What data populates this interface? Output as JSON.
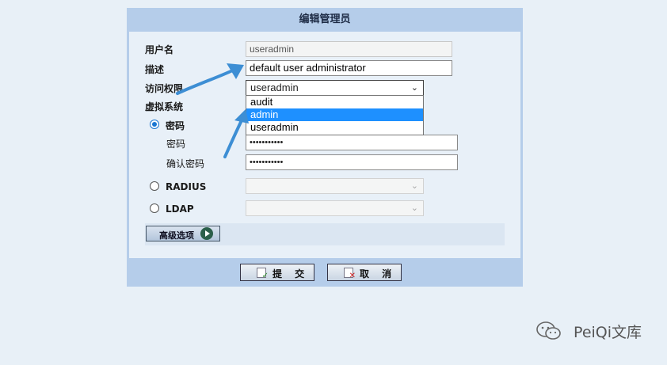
{
  "dialog": {
    "title": "编辑管理员"
  },
  "form": {
    "username_label": "用户名",
    "username_value": "useradmin",
    "desc_label": "描述",
    "desc_value": "default user administrator",
    "access_label": "访问权限",
    "access_value": "useradmin",
    "access_options": [
      "audit",
      "admin",
      "useradmin"
    ],
    "access_highlighted": "admin",
    "vsys_label": "虚拟系统",
    "password_mode_label": "密码",
    "password_label": "密码",
    "password_value": "•••••••••••",
    "confirm_label": "确认密码",
    "confirm_value": "•••••••••••",
    "radius_label": "RADIUS",
    "ldap_label": "LDAP",
    "advanced_label": "高级选项"
  },
  "buttons": {
    "submit": "提 交",
    "cancel": "取 消"
  },
  "watermark": {
    "text": "PeiQi文库"
  },
  "colors": {
    "header": "#b5cdea",
    "panel": "#e8f0f8",
    "highlight": "#1e90ff",
    "arrow": "#3d8ed4"
  }
}
